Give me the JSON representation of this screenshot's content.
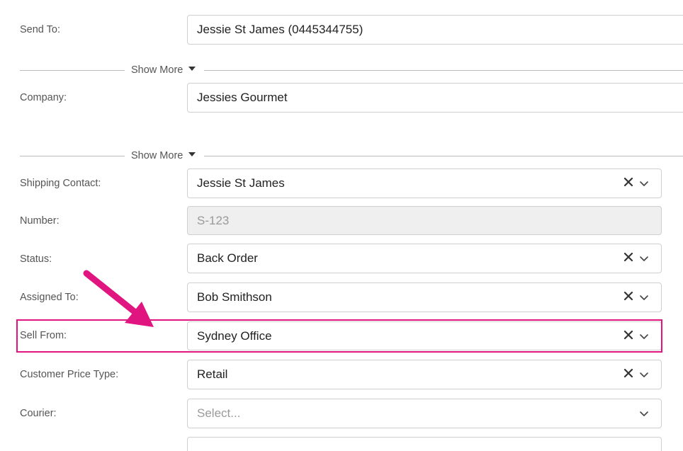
{
  "form": {
    "send_to": {
      "label": "Send To:",
      "value": "Jessie St James (0445344755)"
    },
    "show_more_1": "Show More",
    "company": {
      "label": "Company:",
      "value": "Jessies Gourmet"
    },
    "show_more_2": "Show More",
    "shipping_contact": {
      "label": "Shipping Contact:",
      "value": "Jessie St James"
    },
    "number": {
      "label": "Number:",
      "value": "S-123"
    },
    "status": {
      "label": "Status:",
      "value": "Back Order"
    },
    "assigned_to": {
      "label": "Assigned To:",
      "value": "Bob Smithson"
    },
    "sell_from": {
      "label": "Sell From:",
      "value": "Sydney Office"
    },
    "customer_price_type": {
      "label": "Customer Price Type:",
      "value": "Retail"
    },
    "courier": {
      "label": "Courier:",
      "placeholder": "Select..."
    }
  },
  "annotation": {
    "highlight_color": "#e0157f",
    "highlighted_field": "Sell From"
  },
  "icons": {
    "clear": "close-icon",
    "dropdown": "chevron-down-icon",
    "expand": "caret-down-icon"
  }
}
